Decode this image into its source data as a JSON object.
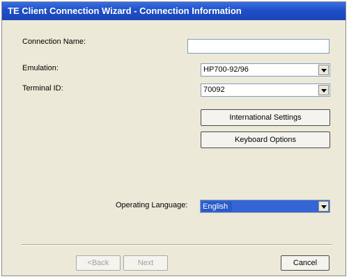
{
  "window": {
    "title": "TE Client Connection Wizard - Connection Information"
  },
  "form": {
    "connection_name_label": "Connection Name:",
    "connection_name_value": "",
    "emulation_label": "Emulation:",
    "emulation_value": "HP700-92/96",
    "terminal_id_label": "Terminal ID:",
    "terminal_id_value": "70092",
    "operating_language_label": "Operating Language:",
    "operating_language_value": "English"
  },
  "buttons": {
    "international_settings": "International Settings",
    "keyboard_options": "Keyboard Options",
    "back": "<Back",
    "next": "Next",
    "cancel": "Cancel"
  },
  "colors": {
    "titlebar": "#1f4fc8",
    "dialog_bg": "#ece9d8",
    "selection": "#2a5ac8"
  }
}
